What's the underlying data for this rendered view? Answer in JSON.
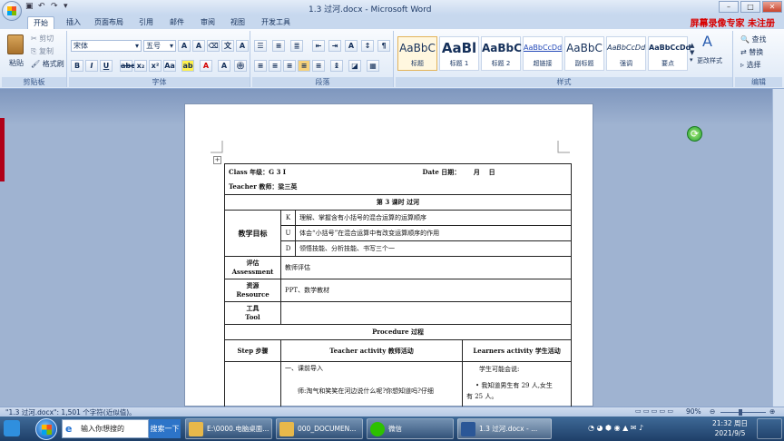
{
  "titlebar": {
    "title": "1.3 过河.docx - Microsoft Word",
    "watermark": "屏幕录像专家 未注册"
  },
  "ribbon_tabs": [
    "开始",
    "插入",
    "页面布局",
    "引用",
    "邮件",
    "审阅",
    "视图",
    "开发工具"
  ],
  "clipboard": {
    "paste": "粘贴",
    "cut": "剪切",
    "copy": "复制",
    "format_painter": "格式刷",
    "label": "剪贴板"
  },
  "font": {
    "name": "宋体",
    "size": "五号",
    "label": "字体"
  },
  "paragraph": {
    "label": "段落"
  },
  "styles": {
    "label": "样式",
    "change_styles": "更改样式",
    "items": [
      {
        "preview": "AaBbC",
        "name": "标题"
      },
      {
        "preview": "AaBl",
        "name": "标题 1"
      },
      {
        "preview": "AaBbC",
        "name": "标题 2"
      },
      {
        "preview": "AaBbCcDd",
        "name": "超链接"
      },
      {
        "preview": "AaBbC",
        "name": "副标题"
      },
      {
        "preview": "AaBbCcDd",
        "name": "强调"
      },
      {
        "preview": "AaBbCcDd",
        "name": "要点"
      }
    ]
  },
  "editing": {
    "label": "编辑",
    "find": "查找",
    "replace": "替换",
    "select": "选择"
  },
  "document": {
    "header_left": "Class 年级：G 3 I",
    "header_date": "Date 日期：",
    "header_month": "月",
    "header_day": "日",
    "teacher": "Teacher 教师：梁三英",
    "lesson_title": "第 3 课时 过河",
    "objectives_label": "教学目标",
    "objectives": [
      {
        "key": "K",
        "text": "理解、掌握含有小括号的混合运算的运算顺序"
      },
      {
        "key": "U",
        "text": "体会“小括号”在混合运算中有改变运算顺序的作用"
      },
      {
        "key": "D",
        "text": "领悟技能、分析技能、书写三个一"
      }
    ],
    "assessment_label": "评估",
    "assessment_en": "Assessment",
    "assessment_value": "教师评估",
    "resource_label": "资源",
    "resource_en": "Resource",
    "resource_value": "PPT、数学教材",
    "tool_label": "工具",
    "tool_en": "Tool",
    "procedure": "Procedure 过程",
    "step_header": "Step 步骤",
    "teacher_activity_header": "Teacher activity 教师活动",
    "learner_activity_header": "Learners activity 学生活动",
    "teacher_line1": "一、课前导入",
    "teacher_line2": "师:淘气和笑笑在河边说什么呢?你想知道吗?仔细",
    "learner_line1": "学生可能会说:",
    "learner_line2": "•  我知道男生有 29 人,女生",
    "learner_line3": "有 25 人。"
  },
  "statusbar": {
    "doc_info": "\"1.3 过河.docx\": 1,501 个字符(近似值)。",
    "zoom": "90%"
  },
  "taskbar": {
    "search_placeholder": "输入你想搜的",
    "search_button": "搜索一下",
    "tasks": [
      {
        "label": "E:\\0000.电脑桌面...",
        "color": "#e8b84a"
      },
      {
        "label": "000_DOCUMEN...",
        "color": "#e8b84a"
      },
      {
        "label": "微信",
        "color": "#2dc100"
      },
      {
        "label": "1.3 过河.docx - ...",
        "color": "#2b5797"
      }
    ],
    "clock_time": "21:32 周日",
    "clock_date": "2021/9/5"
  }
}
